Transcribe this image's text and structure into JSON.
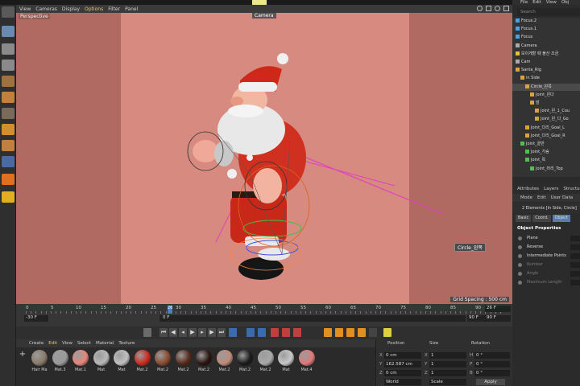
{
  "viewport": {
    "menu": [
      "View",
      "Cameras",
      "Display",
      "Options",
      "Filter",
      "Panel"
    ],
    "active_menu": "Options",
    "title": "Perspective",
    "camera": "Camera",
    "grid_spacing": "Grid Spacing : 500 cm",
    "selection_tag": "Circle_왼쪽"
  },
  "timeline": {
    "ticks": [
      "0",
      "5",
      "10",
      "15",
      "20",
      "25",
      "30",
      "35",
      "40",
      "45",
      "50",
      "55",
      "60",
      "65",
      "70",
      "75",
      "80",
      "85",
      "90"
    ],
    "current_label": "26",
    "right_frame_top": "26 F",
    "left_frame": "-30 F",
    "current_frame_field": "0 F",
    "mid_frame": "90 F",
    "right_frame_bottom": "90 F"
  },
  "materials": {
    "menu": [
      "Create",
      "Edit",
      "View",
      "Select",
      "Material",
      "Texture"
    ],
    "active_menu": "Edit",
    "items": [
      {
        "label": "Hair Ma",
        "color": "#8a7a6a"
      },
      {
        "label": "Mat.3",
        "color": "#9a9a9a"
      },
      {
        "label": "Mat.1",
        "color": "#e8857a"
      },
      {
        "label": "Mat",
        "color": "#b8b8b8"
      },
      {
        "label": "Mat",
        "color": "#c0c0c0"
      },
      {
        "label": "Mat.2",
        "color": "#cc2a1e"
      },
      {
        "label": "Mat.2",
        "color": "#8a4a2e"
      },
      {
        "label": "Mat.2",
        "color": "#5a2a1a"
      },
      {
        "label": "Mat.2",
        "color": "#2a1410"
      },
      {
        "label": "Mat.2",
        "color": "#c08a78"
      },
      {
        "label": "Mat.2",
        "color": "#1a1a1a"
      },
      {
        "label": "Mat.2",
        "color": "#a8a8a8"
      },
      {
        "label": "Mat",
        "color": "#c8c8c8"
      },
      {
        "label": "Mat.4",
        "color": "#e0787a"
      }
    ]
  },
  "coordinates": {
    "headers": [
      "Position",
      "Size",
      "Rotation"
    ],
    "rows": [
      {
        "axis": "X",
        "position": "0 cm",
        "size_axis": "X",
        "size": "1",
        "rot_axis": "H",
        "rotation": "0 °"
      },
      {
        "axis": "Y",
        "position": "162.587 cm",
        "size_axis": "Y",
        "size": "1",
        "rot_axis": "P",
        "rotation": "0 °"
      },
      {
        "axis": "Z",
        "position": "0 cm",
        "size_axis": "Z",
        "size": "1",
        "rot_axis": "B",
        "rotation": "0 °"
      }
    ],
    "world": "World",
    "scale": "Scale",
    "apply": "Apply"
  },
  "object_manager": {
    "menu": [
      "File",
      "Edit",
      "View",
      "Obj"
    ],
    "search": "Search",
    "objects": [
      {
        "name": "Focus.2",
        "indent": 0,
        "color": "#4aa0e0"
      },
      {
        "name": "Focus.1",
        "indent": 0,
        "color": "#4aa0e0"
      },
      {
        "name": "Focus",
        "indent": 0,
        "color": "#4aa0e0"
      },
      {
        "name": "Camera",
        "indent": 0,
        "color": "#aaaaaa"
      },
      {
        "name": "보이게할 때 불산 조금",
        "indent": 0,
        "color": "#e0c040"
      },
      {
        "name": "Cam",
        "indent": 0,
        "color": "#aaaaaa"
      },
      {
        "name": "Santa_Rig",
        "indent": 0,
        "color": "#e0a040"
      },
      {
        "name": "in Side",
        "indent": 1,
        "color": "#e0a040"
      },
      {
        "name": "Circle_왼쪽",
        "indent": 2,
        "color": "#e0a040"
      },
      {
        "name": "Joint_왼다",
        "indent": 3,
        "color": "#e0a040"
      },
      {
        "name": "발",
        "indent": 3,
        "color": "#e0a040"
      },
      {
        "name": "Joint_왼_1_Cou",
        "indent": 4,
        "color": "#e0a040"
      },
      {
        "name": "Joint_왼_다_Go",
        "indent": 4,
        "color": "#e0a040"
      },
      {
        "name": "Joint_다리_Goal_L",
        "indent": 2,
        "color": "#e0a040"
      },
      {
        "name": "Joint_다리_Goal_R",
        "indent": 2,
        "color": "#e0a040"
      },
      {
        "name": "Joint_골반",
        "indent": 1,
        "color": "#50c050"
      },
      {
        "name": "Joint_가슴",
        "indent": 2,
        "color": "#50c050"
      },
      {
        "name": "Joint_목",
        "indent": 2,
        "color": "#50c050"
      },
      {
        "name": "Joint_머리_Top",
        "indent": 3,
        "color": "#50c050"
      }
    ]
  },
  "attributes": {
    "tabs": [
      "Attributes",
      "Layers",
      "Structure"
    ],
    "menu": [
      "Mode",
      "Edit",
      "User Data"
    ],
    "selection": "2 Elements [In Side, Circle]",
    "subtabs": [
      "Basic",
      "Coord.",
      "Object"
    ],
    "active_subtab": "Object",
    "section": "Object Properties",
    "props": [
      "Plane",
      "Reverse",
      "Intermediate Points",
      "Number",
      "Angle",
      "Maximum Length"
    ]
  }
}
